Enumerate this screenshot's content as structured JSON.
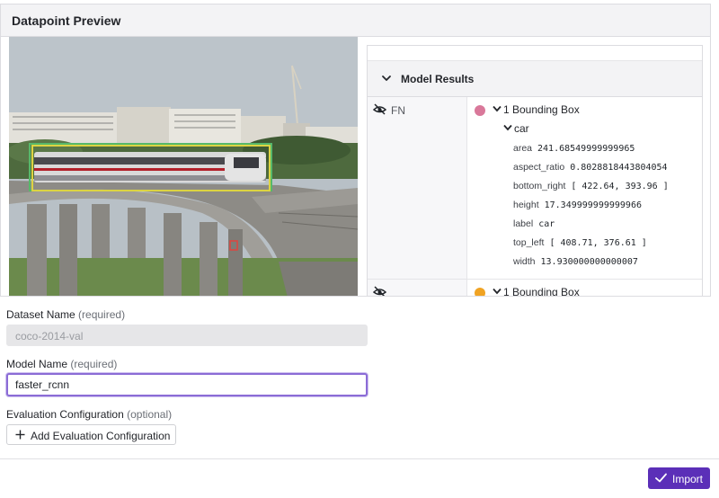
{
  "panel": {
    "title": "Datapoint Preview"
  },
  "model_results": {
    "header_label": "Model Results",
    "rows": [
      {
        "type_label": "FN",
        "dot_color": "#d9789a",
        "bbox_label": "1 Bounding Box",
        "category": "car",
        "attributes": [
          {
            "name": "area",
            "value": "241.68549999999965"
          },
          {
            "name": "aspect_ratio",
            "value": "0.8028818443804054"
          },
          {
            "name": "bottom_right",
            "value": "[ 422.64, 393.96 ]"
          },
          {
            "name": "height",
            "value": "17.349999999999966"
          },
          {
            "name": "label",
            "value": "car"
          },
          {
            "name": "top_left",
            "value": "[ 408.71, 376.61 ]"
          },
          {
            "name": "width",
            "value": "13.930000000000007"
          }
        ]
      },
      {
        "type_label": "",
        "dot_color": "#f0a323",
        "bbox_label": "1 Bounding Box"
      }
    ]
  },
  "form": {
    "dataset_name": {
      "label": "Dataset Name",
      "note": "(required)",
      "value": "coco-2014-val"
    },
    "model_name": {
      "label": "Model Name",
      "note": "(required)",
      "value": "faster_rcnn"
    },
    "evaluation_config": {
      "label": "Evaluation Configuration",
      "note": "(optional)",
      "button_label": "Add Evaluation Configuration"
    }
  },
  "footer": {
    "import_label": "Import"
  },
  "colors": {
    "accent": "#5b2fb8",
    "focus_border": "#8b6cd6",
    "bbox_green": "#57b86a",
    "bbox_yellow": "#dcd442",
    "bbox_red": "#e0443e"
  },
  "icons": {
    "collapse": "chevron-down-icon",
    "visibility": "eye-slash-icon",
    "add": "plus-icon",
    "confirm": "check-icon"
  }
}
